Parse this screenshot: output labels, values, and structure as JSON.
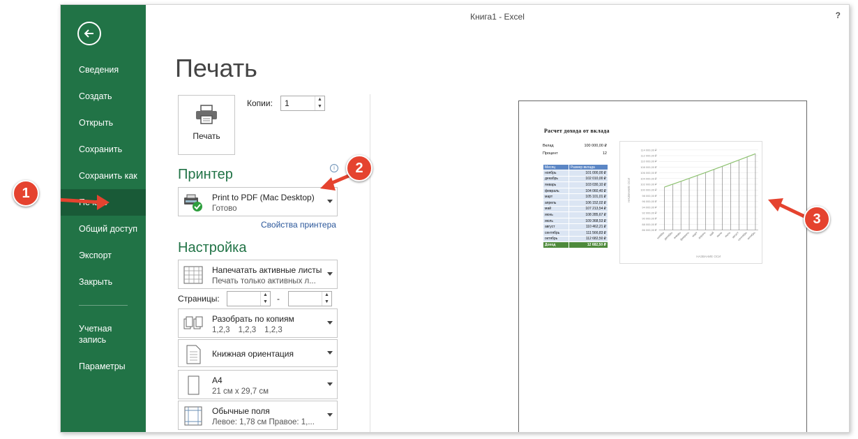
{
  "window": {
    "title": "Книга1 - Excel",
    "help": "?"
  },
  "sidebar": {
    "items": [
      {
        "label": "Сведения"
      },
      {
        "label": "Создать"
      },
      {
        "label": "Открыть"
      },
      {
        "label": "Сохранить"
      },
      {
        "label": "Сохранить как"
      },
      {
        "label": "Печать",
        "active": true
      },
      {
        "label": "Общий доступ"
      },
      {
        "label": "Экспорт"
      },
      {
        "label": "Закрыть"
      }
    ],
    "account": "Учетная запись",
    "options": "Параметры"
  },
  "page": {
    "title": "Печать"
  },
  "print": {
    "button_label": "Печать",
    "copies_label": "Копии:",
    "copies_value": "1"
  },
  "printer": {
    "section": "Принтер",
    "name": "Print to PDF (Mac Desktop)",
    "status": "Готово",
    "properties_link": "Свойства принтера"
  },
  "settings": {
    "section": "Настройка",
    "what": {
      "l1": "Напечатать активные листы",
      "l2": "Печать только активных л..."
    },
    "pages_label": "Страницы:",
    "pages_dash": "-",
    "collate": {
      "l1": "Разобрать по копиям",
      "l2": [
        "1,2,3",
        "1,2,3",
        "1,2,3"
      ]
    },
    "orientation": {
      "l1": "Книжная ориентация"
    },
    "paper": {
      "l1": "A4",
      "l2": "21 см x 29,7 см"
    },
    "margins": {
      "l1": "Обычные поля",
      "l2": "Левое: 1,78 см   Правое: 1,..."
    }
  },
  "preview": {
    "title": "Расчет дохода от вклада",
    "deposit_label": "Вклад",
    "deposit_value": "100 000,00 ₽",
    "rate_label": "Процент",
    "rate_value": "12",
    "table_headers": [
      "Месяц",
      "Размер вклада"
    ],
    "rows": [
      [
        "ноябрь",
        "101 000,00 ₽"
      ],
      [
        "декабрь",
        "102 010,00 ₽"
      ],
      [
        "январь",
        "103 030,10 ₽"
      ],
      [
        "февраль",
        "104 060,40 ₽"
      ],
      [
        "март",
        "105 101,01 ₽"
      ],
      [
        "апрель",
        "106 152,02 ₽"
      ],
      [
        "май",
        "107 213,54 ₽"
      ],
      [
        "июнь",
        "108 285,67 ₽"
      ],
      [
        "июль",
        "109 368,53 ₽"
      ],
      [
        "август",
        "110 462,21 ₽"
      ],
      [
        "сентябрь",
        "111 566,83 ₽"
      ],
      [
        "октябрь",
        "112 682,50 ₽"
      ]
    ],
    "total": [
      "Доход",
      "12 682,50 ₽"
    ],
    "chart_data": {
      "type": "line",
      "categories": [
        "ноябрь",
        "декабрь",
        "январь",
        "февраль",
        "март",
        "апрель",
        "май",
        "июнь",
        "июль",
        "август",
        "сентябрь",
        "октябрь"
      ],
      "series": [
        {
          "values": [
            101000,
            102010,
            103030.1,
            104060.4,
            105101.01,
            106152.02,
            107213.54,
            108285.67,
            109368.53,
            110462.21,
            111566.83,
            112682.5
          ]
        }
      ],
      "yticks": [
        "114 000,00 ₽",
        "112 000,00 ₽",
        "110 000,00 ₽",
        "108 000,00 ₽",
        "106 000,00 ₽",
        "104 000,00 ₽",
        "102 000,00 ₽",
        "100 000,00 ₽",
        "98 000,00 ₽",
        "96 000,00 ₽",
        "94 000,00 ₽",
        "92 000,00 ₽",
        "90 000,00 ₽",
        "88 000,00 ₽",
        "86 000,00 ₽"
      ],
      "ylim": [
        86000,
        114000
      ],
      "xlabel": "НАЗВАНИЕ ОСИ",
      "ylabel": "НАЗВАНИЕ ОСИ",
      "line_color": "#8dc26f"
    }
  },
  "callouts": [
    "1",
    "2",
    "3"
  ],
  "colors": {
    "excel_green": "#217346",
    "active_green": "#195a37",
    "callout_red": "#e5432f",
    "link_blue": "#2b579a"
  }
}
